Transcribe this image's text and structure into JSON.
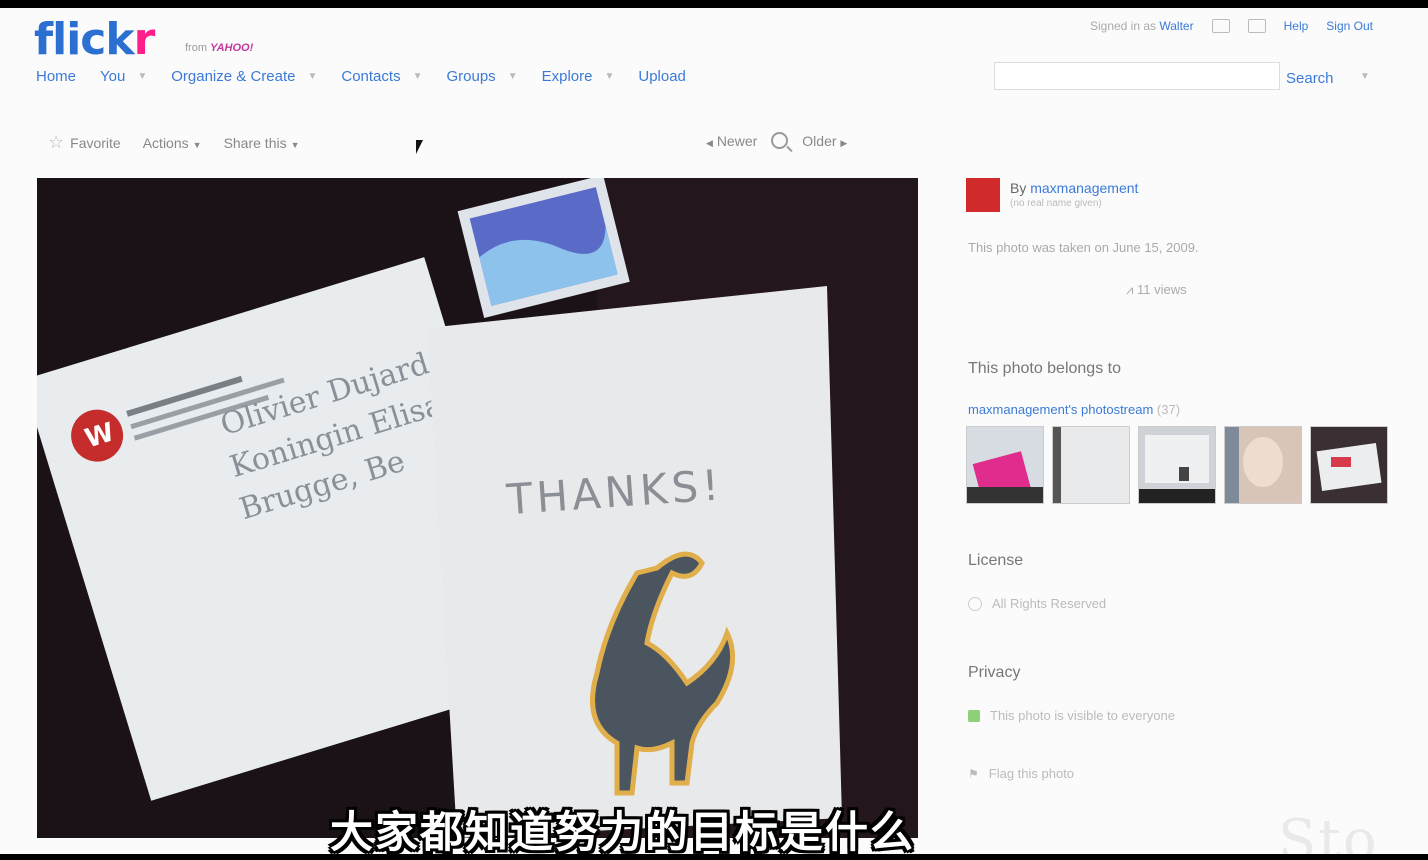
{
  "header": {
    "logo_a": "flick",
    "logo_b": "r",
    "tagline_from": "from",
    "tagline_brand": "YAHOO!",
    "nav": [
      {
        "label": "Home"
      },
      {
        "label": "You"
      },
      {
        "label": "Organize & Create"
      },
      {
        "label": "Contacts"
      },
      {
        "label": "Groups"
      },
      {
        "label": "Explore"
      },
      {
        "label": "Upload"
      }
    ],
    "signed_in_as": "Signed in as",
    "user": "Walter",
    "help": "Help",
    "sign_out": "Sign Out",
    "search_placeholder": "",
    "search_label": "Search"
  },
  "toolbar": {
    "favorite": "Favorite",
    "actions": "Actions",
    "share": "Share this",
    "newer": "Newer",
    "older": "Older"
  },
  "photo": {
    "card_text": "THANKS!",
    "envelope_line1": "Olivier Dujard",
    "envelope_line2": "Koningin Elisab",
    "envelope_line3": "Brugge, Be"
  },
  "sidebar": {
    "by_prefix": "By",
    "owner": "maxmanagement",
    "owner_sub": "(no real name given)",
    "taken": "This photo was taken on June 15, 2009.",
    "views": "11 views",
    "belongs_heading": "This photo belongs to",
    "stream_link": "maxmanagement's photostream",
    "stream_count": "(37)",
    "license_heading": "License",
    "license_text": "All Rights Reserved",
    "privacy_heading": "Privacy",
    "privacy_text": "This photo is visible to everyone",
    "flag_text": "Flag this photo"
  },
  "subtitle": "大家都知道努力的目标是什么",
  "watermark": "Sto",
  "colors": {
    "link_blue": "#3b7ad8",
    "flickr_pink": "#ff1f8a",
    "avatar_red": "#d12a2a"
  }
}
